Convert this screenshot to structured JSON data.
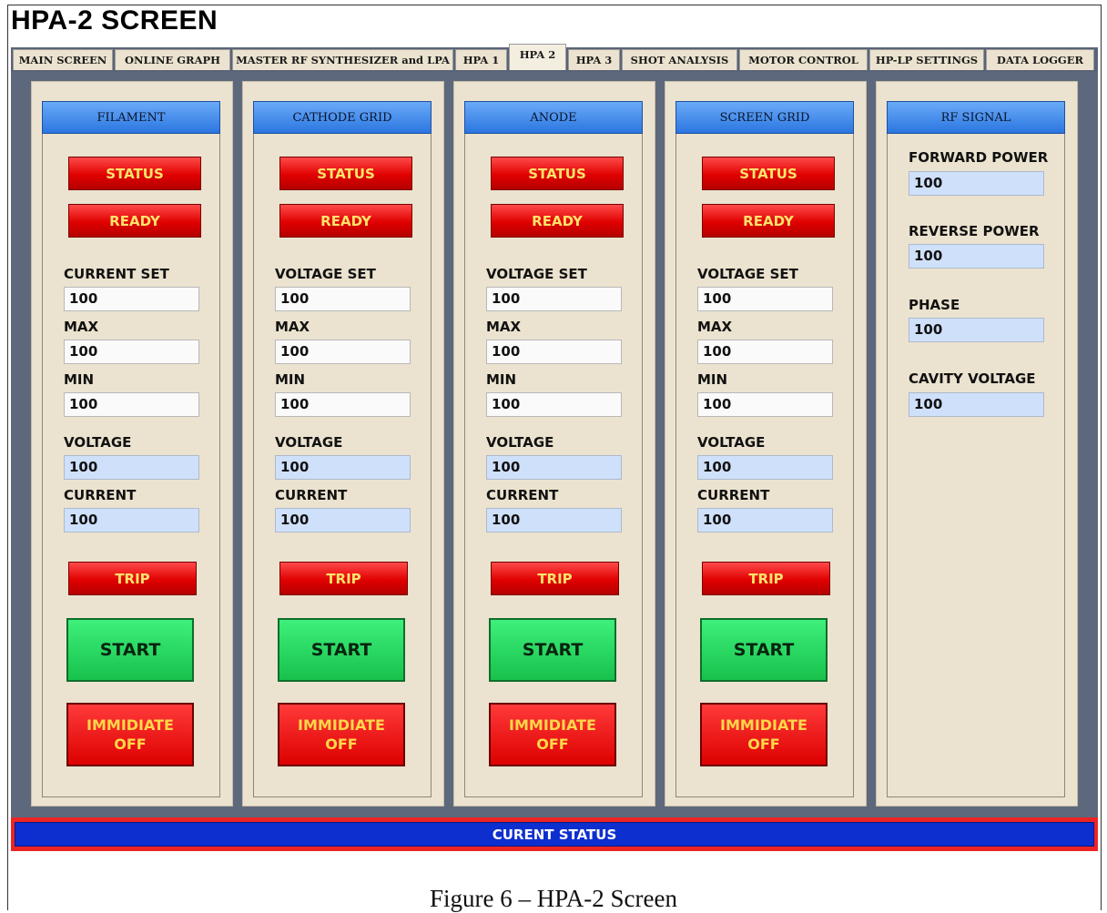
{
  "screen_title": "HPA-2 SCREEN",
  "tabs": [
    {
      "label": "MAIN SCREEN"
    },
    {
      "label": "ONLINE GRAPH"
    },
    {
      "label": "MASTER RF SYNTHESIZER and LPA"
    },
    {
      "label": "HPA 1"
    },
    {
      "label": "HPA 2",
      "active": true
    },
    {
      "label": "HPA 3"
    },
    {
      "label": "SHOT ANALYSIS"
    },
    {
      "label": "MOTOR CONTROL"
    },
    {
      "label": "HP-LP SETTINGS"
    },
    {
      "label": "DATA LOGGER"
    }
  ],
  "panels": [
    {
      "header": "FILAMENT",
      "status_label": "STATUS",
      "ready_label": "READY",
      "set_label": "CURRENT SET",
      "set_value": "100",
      "max_label": "MAX",
      "max_value": "100",
      "min_label": "MIN",
      "min_value": "100",
      "voltage_label": "VOLTAGE",
      "voltage_value": "100",
      "current_label": "CURRENT",
      "current_value": "100",
      "trip_label": "TRIP",
      "start_label": "START",
      "off_label": "IMMIDIATE\nOFF"
    },
    {
      "header": "CATHODE GRID",
      "status_label": "STATUS",
      "ready_label": "READY",
      "set_label": "VOLTAGE SET",
      "set_value": "100",
      "max_label": "MAX",
      "max_value": "100",
      "min_label": "MIN",
      "min_value": "100",
      "voltage_label": "VOLTAGE",
      "voltage_value": "100",
      "current_label": "CURRENT",
      "current_value": "100",
      "trip_label": "TRIP",
      "start_label": "START",
      "off_label": "IMMIDIATE\nOFF"
    },
    {
      "header": "ANODE",
      "status_label": "STATUS",
      "ready_label": "READY",
      "set_label": "VOLTAGE SET",
      "set_value": "100",
      "max_label": "MAX",
      "max_value": "100",
      "min_label": "MIN",
      "min_value": "100",
      "voltage_label": "VOLTAGE",
      "voltage_value": "100",
      "current_label": "CURRENT",
      "current_value": "100",
      "trip_label": "TRIP",
      "start_label": "START",
      "off_label": "IMMIDIATE\nOFF"
    },
    {
      "header": "SCREEN GRID",
      "status_label": "STATUS",
      "ready_label": "READY",
      "set_label": "VOLTAGE SET",
      "set_value": "100",
      "max_label": "MAX",
      "max_value": "100",
      "min_label": "MIN",
      "min_value": "100",
      "voltage_label": "VOLTAGE",
      "voltage_value": "100",
      "current_label": "CURRENT",
      "current_value": "100",
      "trip_label": "TRIP",
      "start_label": "START",
      "off_label": "IMMIDIATE\nOFF"
    }
  ],
  "rf_signal": {
    "header": "RF SIGNAL",
    "forward_power_label": "FORWARD POWER",
    "forward_power_value": "100",
    "reverse_power_label": "REVERSE POWER",
    "reverse_power_value": "100",
    "phase_label": "PHASE",
    "phase_value": "100",
    "cavity_voltage_label": "CAVITY VOLTAGE",
    "cavity_voltage_value": "100"
  },
  "status_bar": "CURENT STATUS",
  "caption": "Figure 6 – HPA-2 Screen",
  "colors": {
    "panel_bg": "#ebe3cf",
    "workspace_bg": "#5e687c",
    "header_blue": "#2b76e0",
    "indicator_red": "#e00000",
    "indicator_text": "#ffe36a",
    "start_green": "#17c14c",
    "readonly_field": "#cfe0fb",
    "status_bar_blue": "#0d2fd0",
    "status_bar_border": "#ee2424"
  }
}
